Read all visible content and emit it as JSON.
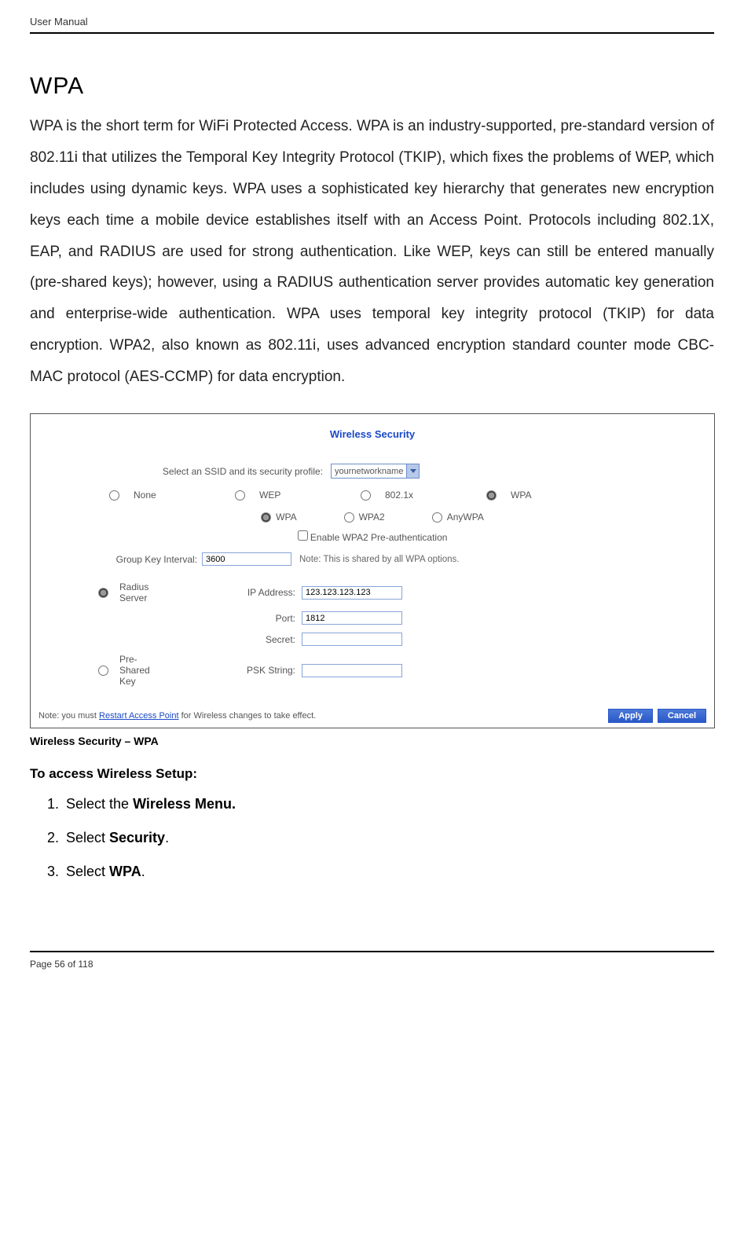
{
  "header": {
    "doc_title": "User Manual"
  },
  "section": {
    "title": "WPA",
    "body": "WPA is the short term for WiFi Protected Access. WPA is an industry-supported, pre-standard version of 802.11i that utilizes the Temporal Key Integrity Protocol (TKIP), which fixes the problems of WEP, which includes using dynamic keys. WPA uses a sophisticated key hierarchy that generates new encryption keys each time a mobile device establishes itself with an Access Point. Protocols including 802.1X, EAP, and RADIUS are used for strong authentication. Like WEP, keys can still be entered manually (pre-shared keys); however, using a RADIUS authentication server provides automatic key generation and enterprise-wide authentication. WPA uses temporal key integrity protocol (TKIP) for data encryption. WPA2, also known as 802.11i, uses advanced encryption standard counter mode CBC-MAC protocol (AES-CCMP) for data encryption."
  },
  "screenshot": {
    "panel_title": "Wireless Security",
    "ssid_label": "Select an SSID and its security profile:",
    "ssid_value": "yournetworkname",
    "modes": [
      "None",
      "WEP",
      "802.1x",
      "WPA"
    ],
    "mode_selected": "WPA",
    "wpa_sub": [
      "WPA",
      "WPA2",
      "AnyWPA"
    ],
    "wpa_sub_selected": "WPA",
    "preauth_label": "Enable WPA2 Pre-authentication",
    "group_key_label": "Group Key Interval:",
    "group_key_value": "3600",
    "group_key_note": "Note: This is shared by all WPA options.",
    "radius_label": "Radius Server",
    "ip_label": "IP Address:",
    "ip_value": "123.123.123.123",
    "port_label": "Port:",
    "port_value": "1812",
    "secret_label": "Secret:",
    "secret_value": "",
    "psk_label": "Pre-Shared Key",
    "psk_string_label": "PSK String:",
    "psk_string_value": "",
    "footer_note_prefix": "Note: you must ",
    "footer_note_link": "Restart Access Point",
    "footer_note_suffix": " for Wireless changes to take effect.",
    "apply_label": "Apply",
    "cancel_label": "Cancel"
  },
  "caption": "Wireless Security – WPA",
  "access": {
    "heading": "To access Wireless Setup:",
    "step1_prefix": "Select the ",
    "step1_bold": "Wireless Menu.",
    "step2_prefix": "Select ",
    "step2_bold": "Security",
    "step2_suffix": ".",
    "step3_prefix": "Select ",
    "step3_bold": "WPA",
    "step3_suffix": "."
  },
  "footer": {
    "page_label": "Page 56 of 118"
  }
}
